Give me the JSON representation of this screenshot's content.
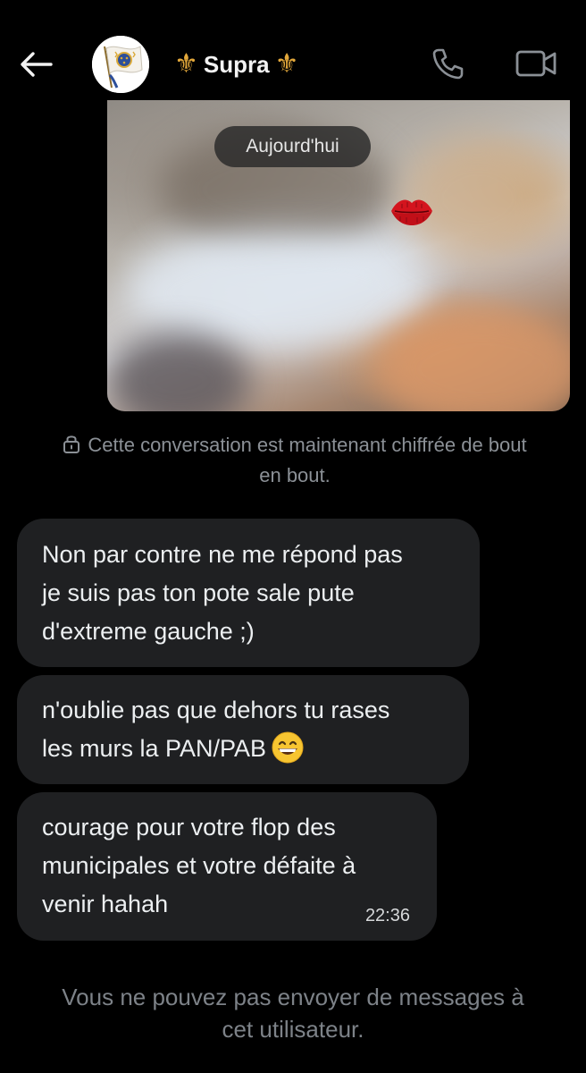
{
  "header": {
    "back_icon": "arrow-left-icon",
    "avatar_icon": "royal-flag-avatar",
    "title_prefix_glyph": "⚜",
    "title": "Supra",
    "title_suffix_glyph": "⚜",
    "call_icon": "phone-icon",
    "video_icon": "video-camera-icon",
    "accent_color": "#e2a73a"
  },
  "media": {
    "date_label": "Aujourd'hui",
    "sticker_icon": "kiss-lips-icon"
  },
  "encryption_notice": {
    "icon": "lock-icon",
    "text_line1": "Cette conversation est maintenant chiffrée de bout",
    "text_line2": "en bout."
  },
  "messages": [
    {
      "lines": [
        "Non par contre ne me répond pas",
        "je suis pas ton pote sale pute",
        "d'extreme gauche ;)"
      ]
    },
    {
      "lines": [
        "n'oublie pas que dehors tu rases",
        "les murs la PAN/PAB"
      ],
      "emoji": "grinning-face-emoji"
    },
    {
      "lines": [
        "courage pour votre flop des",
        "municipales et votre défaite à",
        "venir hahah"
      ],
      "time": "22:36"
    }
  ],
  "footer": {
    "line1": "Vous ne pouvez pas envoyer de messages à",
    "line2": "cet utilisateur."
  }
}
